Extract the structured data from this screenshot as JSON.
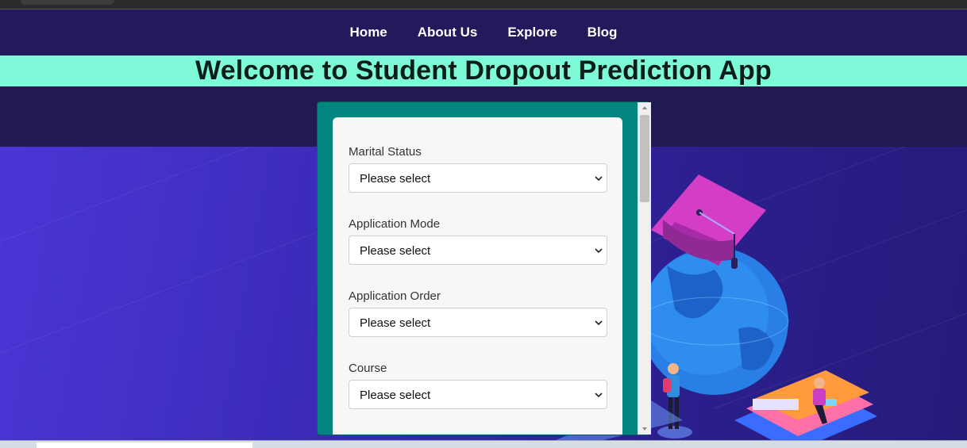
{
  "nav": {
    "items": [
      {
        "label": "Home"
      },
      {
        "label": "About Us"
      },
      {
        "label": "Explore"
      },
      {
        "label": "Blog"
      }
    ]
  },
  "banner": {
    "title": "Welcome to Student Dropout Prediction App"
  },
  "form": {
    "fields": [
      {
        "label": "Marital Status",
        "value": "Please select"
      },
      {
        "label": "Application Mode",
        "value": "Please select"
      },
      {
        "label": "Application Order",
        "value": "Please select"
      },
      {
        "label": "Course",
        "value": "Please select"
      }
    ]
  },
  "colors": {
    "navbar_bg": "#231a5c",
    "banner_bg": "#7ffad8",
    "form_frame": "#008580",
    "form_card": "#f7f7f7",
    "hero_gradient_start": "#4a36d6",
    "hero_gradient_end": "#261b7a"
  },
  "icons": {
    "select_arrow": "chevron-down-icon",
    "hero": "graduation-cap-globe-books-illustration"
  }
}
